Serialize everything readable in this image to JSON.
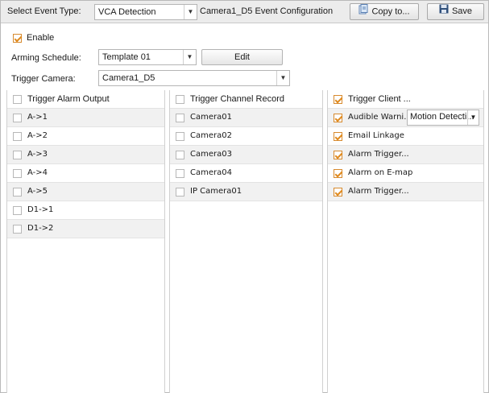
{
  "toolbar": {
    "event_type_label": "Select Event Type:",
    "event_type_value": "VCA Detection",
    "config_title": "Camera1_D5 Event Configuration",
    "copy_label": "Copy to...",
    "save_label": "Save"
  },
  "form": {
    "enable_label": "Enable",
    "enable_checked": true,
    "arming_label": "Arming Schedule:",
    "arming_value": "Template 01",
    "edit_label": "Edit",
    "trigger_camera_label": "Trigger Camera:",
    "trigger_camera_value": "Camera1_D5"
  },
  "columns": {
    "alarm_output": {
      "header": "Trigger Alarm Output",
      "items": [
        "A->1",
        "A->2",
        "A->3",
        "A->4",
        "A->5",
        "D1->1",
        "D1->2"
      ]
    },
    "channel_record": {
      "header": "Trigger Channel Record",
      "items": [
        "Camera01",
        "Camera02",
        "Camera03",
        "Camera04",
        "IP Camera01"
      ]
    },
    "linkage": {
      "header": "Trigger Client ...",
      "items": [
        "Audible Warni...",
        "Email Linkage",
        "Alarm Trigger...",
        "Alarm on E-map",
        "Alarm Trigger..."
      ],
      "audible_select_value": "Motion Detecti..."
    }
  },
  "colors": {
    "check_accent": "#e08a1e",
    "toolbar_bg": "#ececec",
    "alt_row_bg": "#f1f1f1"
  }
}
